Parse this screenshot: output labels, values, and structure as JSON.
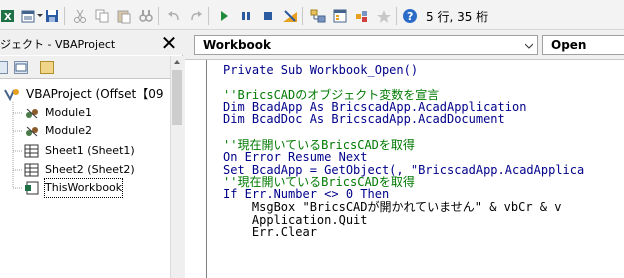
{
  "toolbar": {
    "buttons": [
      {
        "name": "save-icon",
        "label": ""
      },
      {
        "name": "insert-module-icon",
        "label": ""
      },
      {
        "name": "cut-icon",
        "label": ""
      },
      {
        "name": "copy-icon",
        "label": ""
      },
      {
        "name": "paste-icon",
        "label": ""
      },
      {
        "name": "find-icon",
        "label": ""
      },
      {
        "name": "undo-icon",
        "label": ""
      },
      {
        "name": "redo-icon",
        "label": ""
      },
      {
        "name": "run-icon",
        "label": ""
      },
      {
        "name": "pause-icon",
        "label": ""
      },
      {
        "name": "stop-icon",
        "label": ""
      },
      {
        "name": "design-mode-icon",
        "label": ""
      },
      {
        "name": "project-explorer-icon",
        "label": ""
      },
      {
        "name": "properties-icon",
        "label": ""
      },
      {
        "name": "object-browser-icon",
        "label": ""
      },
      {
        "name": "toolbox-icon",
        "label": ""
      },
      {
        "name": "help-icon",
        "label": ""
      }
    ],
    "status": "5 行, 35 桁"
  },
  "project_panel": {
    "title": "ジェクト - VBAProject",
    "close_label": "✕",
    "project_root": "VBAProject (Offset【09",
    "items": [
      {
        "label": "Module1",
        "icon": "module-icon"
      },
      {
        "label": "Module2",
        "icon": "module-icon"
      },
      {
        "label": "Sheet1 (Sheet1)",
        "icon": "sheet-icon"
      },
      {
        "label": "Sheet2 (Sheet2)",
        "icon": "sheet-icon"
      },
      {
        "label": "ThisWorkbook",
        "icon": "workbook-icon",
        "selected": true
      }
    ]
  },
  "code_pane": {
    "object_combo": "Workbook",
    "procedure_combo": "Open",
    "lines": [
      {
        "text": "Private Sub Workbook_Open()",
        "style": "kw"
      },
      {
        "text": "",
        "style": "tx"
      },
      {
        "text": "''BricsCADのオブジェクト変数を宣言",
        "style": "cm"
      },
      {
        "text": "Dim BcadApp As BricscadApp.AcadApplication",
        "style": "kw"
      },
      {
        "text": "Dim BcadDoc As BricscadApp.AcadDocument",
        "style": "kw"
      },
      {
        "text": "",
        "style": "tx"
      },
      {
        "text": "''現在開いているBricsCADを取得",
        "style": "cm"
      },
      {
        "text": "On Error Resume Next",
        "style": "kw"
      },
      {
        "text": "Set BcadApp = GetObject(, \"BricscadApp.AcadApplica",
        "style": "kw"
      },
      {
        "text": "''現在開いているBricsCADを取得",
        "style": "cm"
      },
      {
        "text": "If Err.Number <> 0 Then",
        "style": "kw"
      },
      {
        "text": "    MsgBox \"BricsCADが開かれていません\" & vbCr & v",
        "style": "tx"
      },
      {
        "text": "    Application.Quit",
        "style": "tx"
      },
      {
        "text": "    Err.Clear",
        "style": "tx"
      }
    ]
  }
}
